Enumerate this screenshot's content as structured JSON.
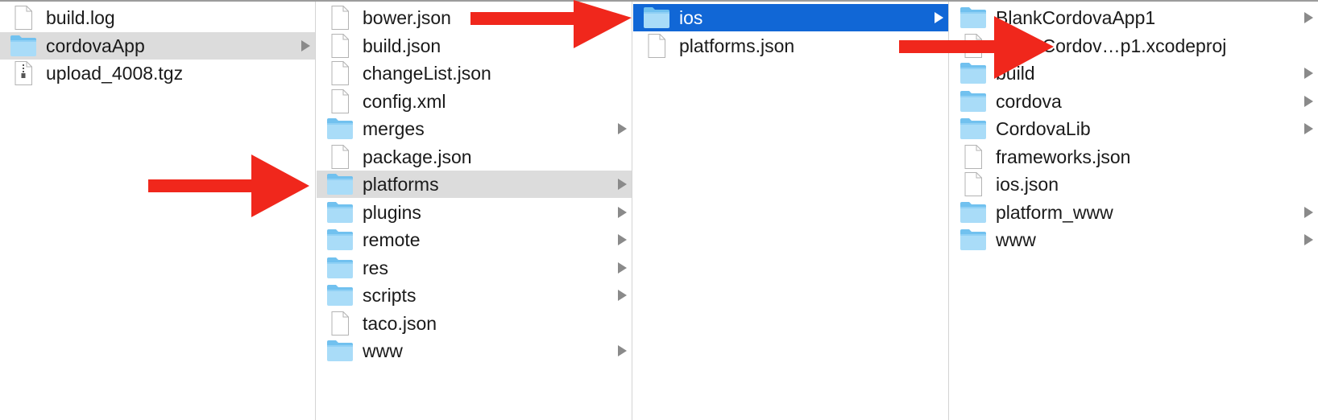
{
  "columns": [
    {
      "items": [
        {
          "label": "build.log",
          "type": "file",
          "folder": false
        },
        {
          "label": "cordovaApp",
          "type": "folder",
          "folder": true,
          "selected": "gray"
        },
        {
          "label": "upload_4008.tgz",
          "type": "archive",
          "folder": false
        }
      ]
    },
    {
      "items": [
        {
          "label": "bower.json",
          "type": "file",
          "folder": false
        },
        {
          "label": "build.json",
          "type": "file",
          "folder": false
        },
        {
          "label": "changeList.json",
          "type": "file",
          "folder": false
        },
        {
          "label": "config.xml",
          "type": "file",
          "folder": false
        },
        {
          "label": "merges",
          "type": "folder",
          "folder": true
        },
        {
          "label": "package.json",
          "type": "file",
          "folder": false
        },
        {
          "label": "platforms",
          "type": "folder",
          "folder": true,
          "selected": "gray"
        },
        {
          "label": "plugins",
          "type": "folder",
          "folder": true
        },
        {
          "label": "remote",
          "type": "folder",
          "folder": true
        },
        {
          "label": "res",
          "type": "folder",
          "folder": true
        },
        {
          "label": "scripts",
          "type": "folder",
          "folder": true
        },
        {
          "label": "taco.json",
          "type": "file",
          "folder": false
        },
        {
          "label": "www",
          "type": "folder",
          "folder": true
        }
      ]
    },
    {
      "items": [
        {
          "label": "ios",
          "type": "folder",
          "folder": true,
          "selected": "blue"
        },
        {
          "label": "platforms.json",
          "type": "file",
          "folder": false
        }
      ]
    },
    {
      "items": [
        {
          "label": "BlankCordovaApp1",
          "type": "folder",
          "folder": true
        },
        {
          "label": "BlankCordov…p1.xcodeproj",
          "type": "xcodeproj",
          "folder": false
        },
        {
          "label": "build",
          "type": "folder",
          "folder": true
        },
        {
          "label": "cordova",
          "type": "folder",
          "folder": true
        },
        {
          "label": "CordovaLib",
          "type": "folder",
          "folder": true
        },
        {
          "label": "frameworks.json",
          "type": "file",
          "folder": false
        },
        {
          "label": "ios.json",
          "type": "file",
          "folder": false
        },
        {
          "label": "platform_www",
          "type": "folder",
          "folder": true
        },
        {
          "label": "www",
          "type": "folder",
          "folder": true
        }
      ]
    }
  ],
  "icons": {
    "folder": "folder-icon",
    "file": "document-icon",
    "archive": "zip-archive-icon",
    "xcodeproj": "xcode-project-icon",
    "disclosure": "chevron-right-icon",
    "annotation": "red-arrow-icon"
  },
  "colors": {
    "selection_blue": "#1167d6",
    "selection_gray": "#dcdcdc",
    "folder_light": "#a9dcf8",
    "folder_dark": "#71c1ef",
    "annotation_red": "#f0271c"
  }
}
